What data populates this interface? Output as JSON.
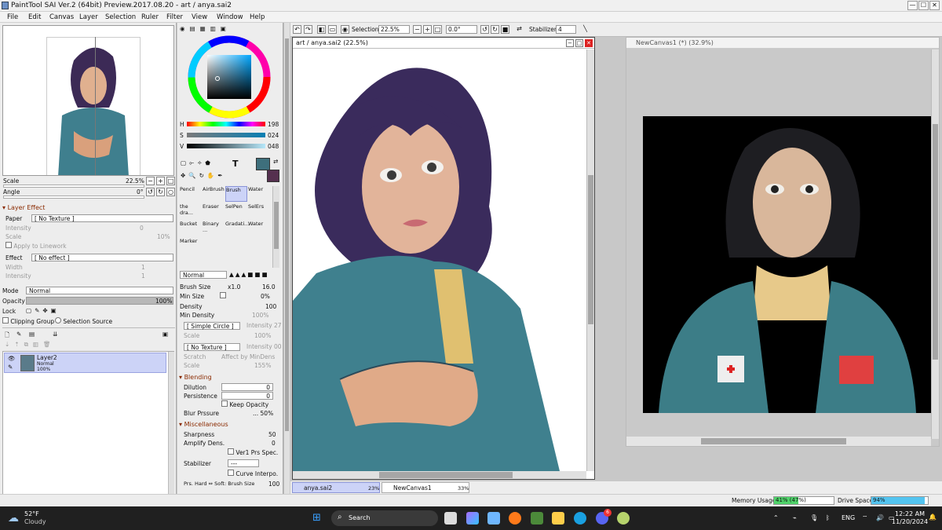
{
  "window": {
    "title": "PaintTool SAI Ver.2 (64bit) Preview.2017.08.20 - art / anya.sai2",
    "minimize": "—",
    "maximize": "☐",
    "close": "✕"
  },
  "menu": [
    "File",
    "Edit",
    "Canvas",
    "Layer",
    "Selection",
    "Ruler",
    "Filter",
    "View",
    "Window",
    "Help"
  ],
  "navigator": {
    "scale_label": "Scale",
    "scale_value": "22.5%",
    "angle_label": "Angle",
    "angle_value": "0°"
  },
  "layer_effect": {
    "title": "Layer Effect",
    "paper_label": "Paper",
    "paper_value": "[ No Texture ]",
    "intensity_label": "Intensity",
    "intensity_value": "0",
    "scale_label": "Scale",
    "scale_value": "10%",
    "apply_linework": "Apply to Linework",
    "effect_label": "Effect",
    "effect_value": "[ No effect ]",
    "width_label": "Width",
    "width_value": "1",
    "effect_intensity_label": "Intensity",
    "effect_intensity_value": "1"
  },
  "layer_props": {
    "mode_label": "Mode",
    "mode_value": "Normal",
    "opacity_label": "Opacity",
    "opacity_value": "100%",
    "lock_label": "Lock",
    "clipping_group": "Clipping Group",
    "selection_source": "Selection Source"
  },
  "layers": [
    {
      "name": "Layer2",
      "mode": "Normal",
      "opacity": "100%"
    }
  ],
  "color": {
    "h_label": "H",
    "h_value": "198",
    "s_label": "S",
    "s_value": "024",
    "v_label": "V",
    "v_value": "048",
    "primary": "#3e6f7c",
    "secondary": "#55304f"
  },
  "tools": [
    "Pencil",
    "AirBrush",
    "Brush",
    "Water",
    "the dra...",
    "Eraser",
    "SelPen",
    "SelErs",
    "Bucket",
    "Binary ...",
    "Gradati...",
    "Water",
    "Marker"
  ],
  "brush": {
    "blend_mode": "Normal",
    "size_label": "Brush Size",
    "size_mult": "x1.0",
    "size_value": "16.0",
    "minsize_label": "Min Size",
    "minsize_value": "0%",
    "density_label": "Density",
    "density_value": "100",
    "mindensity_label": "Min Density",
    "mindensity_value": "100%",
    "shape": "[ Simple Circle ]",
    "shape_intensity": "Intensity 27",
    "shape_scale_label": "Scale",
    "shape_scale_value": "100%",
    "texture": "[ No Texture ]",
    "texture_intensity": "Intensity 00",
    "scratch_label": "Scratch",
    "affect_mindens": "Affect by MinDens",
    "tex_scale_label": "Scale",
    "tex_scale_value": "155%",
    "blending_title": "Blending",
    "blending_label": "Blending",
    "blending_value": "0",
    "dilution_label": "Dilution",
    "dilution_value": "0",
    "persistence_label": "Persistence",
    "persistence_value": "0",
    "keep_opacity": "Keep Opacity",
    "blur_label": "Blur Prssure",
    "blur_value": "... 50%",
    "misc_title": "Miscellaneous",
    "sharpness_label": "Sharpness",
    "sharpness_value": "50",
    "amplify_label": "Amplify Dens.",
    "amplify_value": "0",
    "ver1": "Ver1 Prs Spec.",
    "stabilizer_label": "Stabilizer",
    "stabilizer_value": "---",
    "curve_interpo": "Curve Interpo.",
    "prs_hard": "Prs. Hard ⇔ Soft: Brush Size",
    "prs_value": "100"
  },
  "toolbar": {
    "selection_label": "Selection",
    "zoom_value": "22.5%",
    "angle_value": "0.0°",
    "stabilizer_label": "Stabilizer",
    "stabilizer_value": "4"
  },
  "canvas_main": {
    "title": "art / anya.sai2 (22.5%)"
  },
  "canvas_second": {
    "title": "NewCanvas1 (*) (32.9%)"
  },
  "doc_tabs": [
    {
      "name": "anya.sai2",
      "zoom": "23%"
    },
    {
      "name": "NewCanvas1",
      "zoom": "33%"
    }
  ],
  "status": {
    "memory_label": "Memory Usage",
    "memory_value": "41% (47%)",
    "memory_fraction": 0.41,
    "drive_label": "Drive Space",
    "drive_value": "94%",
    "drive_fraction": 0.94
  },
  "taskbar": {
    "weather_temp": "52°F",
    "weather_desc": "Cloudy",
    "search_placeholder": "Search",
    "lang": "ENG",
    "time": "12:22 AM",
    "date": "11/20/2024",
    "discord_badge": "6"
  }
}
